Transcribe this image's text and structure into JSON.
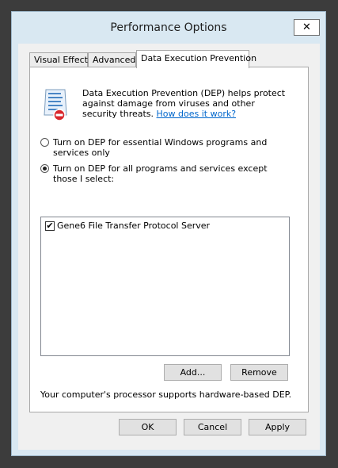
{
  "window": {
    "title": "Performance Options",
    "close_glyph": "✕"
  },
  "tabs": [
    {
      "label": "Visual Effects"
    },
    {
      "label": "Advanced"
    },
    {
      "label": "Data Execution Prevention"
    }
  ],
  "dep": {
    "icon": "dep-shield-binary-icon",
    "description": "Data Execution Prevention (DEP) helps protect against damage from viruses and other security threats.",
    "link_text": "How does it work?",
    "options": [
      {
        "label": "Turn on DEP for essential Windows programs and services only",
        "checked": false
      },
      {
        "label": "Turn on DEP for all programs and services except those I select:",
        "checked": true
      }
    ],
    "programs": [
      {
        "label": "Gene6 File Transfer Protocol Server",
        "checked": true,
        "check_glyph": "✔"
      }
    ],
    "add_label": "Add...",
    "remove_label": "Remove",
    "status": "Your computer's processor supports hardware-based DEP."
  },
  "buttons": {
    "ok": "OK",
    "cancel": "Cancel",
    "apply": "Apply"
  }
}
